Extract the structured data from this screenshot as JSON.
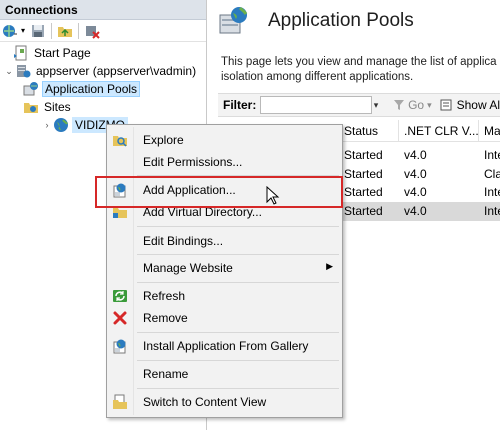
{
  "connections": {
    "title": "Connections",
    "tree": [
      {
        "label": "Start Page",
        "icon": "start-page-icon"
      },
      {
        "label": "appserver (appserver\\vadmin)",
        "icon": "server-icon"
      },
      {
        "label": "Application Pools",
        "icon": "app-pools-icon"
      },
      {
        "label": "Sites",
        "icon": "sites-folder-icon"
      },
      {
        "label": "VIDIZMO",
        "icon": "globe-icon"
      }
    ]
  },
  "main": {
    "title": "Application Pools",
    "description_line1": "This page lets you view and manage the list of applica",
    "description_line2": "isolation among different applications.",
    "filter": {
      "label": "Filter:",
      "go_label": "Go",
      "show_all_label": "Show Al"
    },
    "columns": [
      "Status",
      ".NET CLR V...",
      "Ma"
    ],
    "rows": [
      {
        "status": "Started",
        "clr": "v4.0",
        "mode": "Inte"
      },
      {
        "status": "Started",
        "clr": "v4.0",
        "mode": "Cla"
      },
      {
        "status": "Started",
        "clr": "v4.0",
        "mode": "Inte"
      },
      {
        "status": "Started",
        "clr": "v4.0",
        "mode": "Inte"
      }
    ]
  },
  "context_menu": {
    "items": [
      {
        "label": "Explore",
        "icon": "explore-icon"
      },
      {
        "label": "Edit Permissions...",
        "icon": ""
      },
      {
        "label": "Add Application...",
        "icon": "add-application-icon"
      },
      {
        "label": "Add Virtual Directory...",
        "icon": "add-virtual-directory-icon"
      },
      {
        "label": "Edit Bindings...",
        "icon": ""
      },
      {
        "label": "Manage Website",
        "icon": ""
      },
      {
        "label": "Refresh",
        "icon": "refresh-icon"
      },
      {
        "label": "Remove",
        "icon": "remove-icon"
      },
      {
        "label": "Install Application From Gallery",
        "icon": "gallery-icon"
      },
      {
        "label": "Rename",
        "icon": ""
      },
      {
        "label": "Switch to Content View",
        "icon": "content-view-icon"
      }
    ]
  },
  "colors": {
    "highlight_border": "#d62828",
    "selection": "#cce8ff",
    "remove_red": "#d62828"
  }
}
